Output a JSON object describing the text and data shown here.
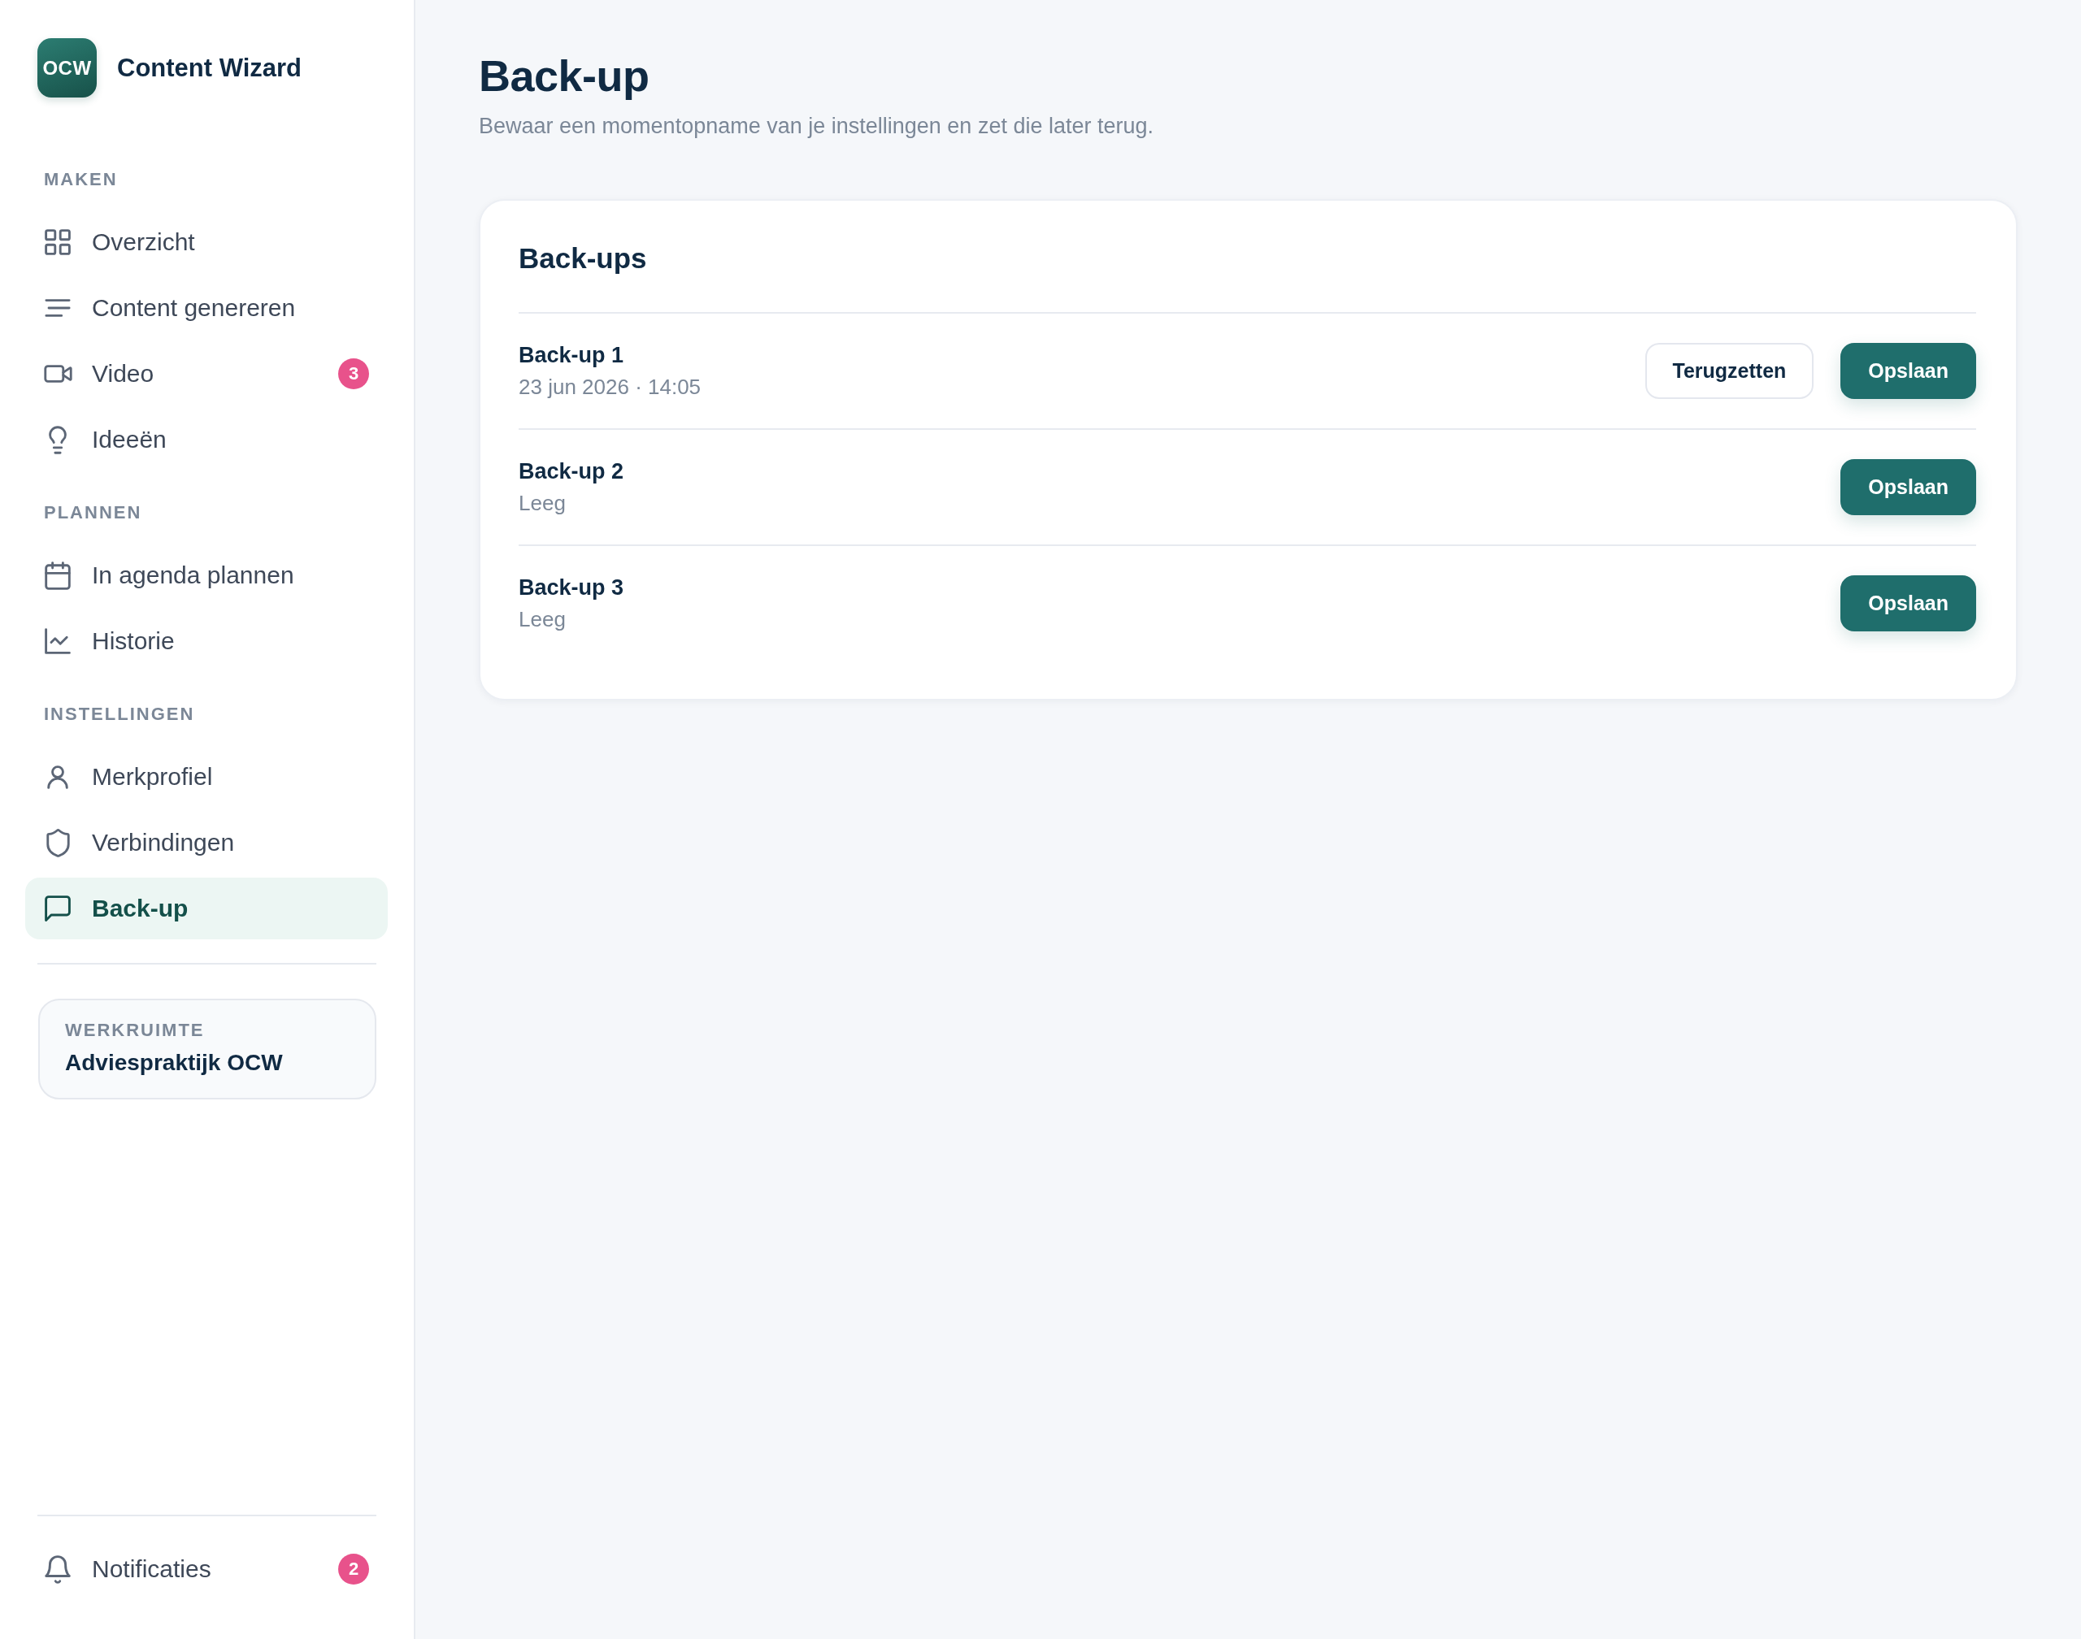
{
  "app": {
    "logo_text": "OCW",
    "name": "Content Wizard"
  },
  "sidebar": {
    "sections": [
      {
        "label": "MAKEN",
        "items": [
          {
            "label": "Overzicht",
            "selected": false
          },
          {
            "label": "Content genereren",
            "selected": false
          },
          {
            "label": "Video",
            "selected": false,
            "badge": "3"
          },
          {
            "label": "Ideeën",
            "selected": false
          }
        ]
      },
      {
        "label": "PLANNEN",
        "items": [
          {
            "label": "In agenda plannen",
            "selected": false
          },
          {
            "label": "Historie",
            "selected": false
          }
        ]
      },
      {
        "label": "INSTELLINGEN",
        "items": [
          {
            "label": "Merkprofiel",
            "selected": false
          },
          {
            "label": "Verbindingen",
            "selected": false
          },
          {
            "label": "Back-up",
            "selected": true
          }
        ]
      }
    ],
    "workspace": {
      "label": "WERKRUIMTE",
      "name": "Adviespraktijk OCW"
    },
    "notifications": {
      "label": "Notificaties",
      "badge": "2"
    }
  },
  "page": {
    "title": "Back-up",
    "subtitle": "Bewaar een momentopname van je instellingen en zet die later terug."
  },
  "card": {
    "title": "Back-ups",
    "rows": [
      {
        "name": "Back-up 1",
        "detail": "23 jun 2026 · 14:05",
        "buttons": [
          {
            "label": "Terugzetten",
            "kind": "secondary"
          },
          {
            "label": "Opslaan",
            "kind": "primary"
          }
        ]
      },
      {
        "name": "Back-up 2",
        "detail": "Leeg",
        "buttons": [
          {
            "label": "Opslaan",
            "kind": "primary"
          }
        ]
      },
      {
        "name": "Back-up 3",
        "detail": "Leeg",
        "buttons": [
          {
            "label": "Opslaan",
            "kind": "primary"
          }
        ]
      }
    ]
  }
}
